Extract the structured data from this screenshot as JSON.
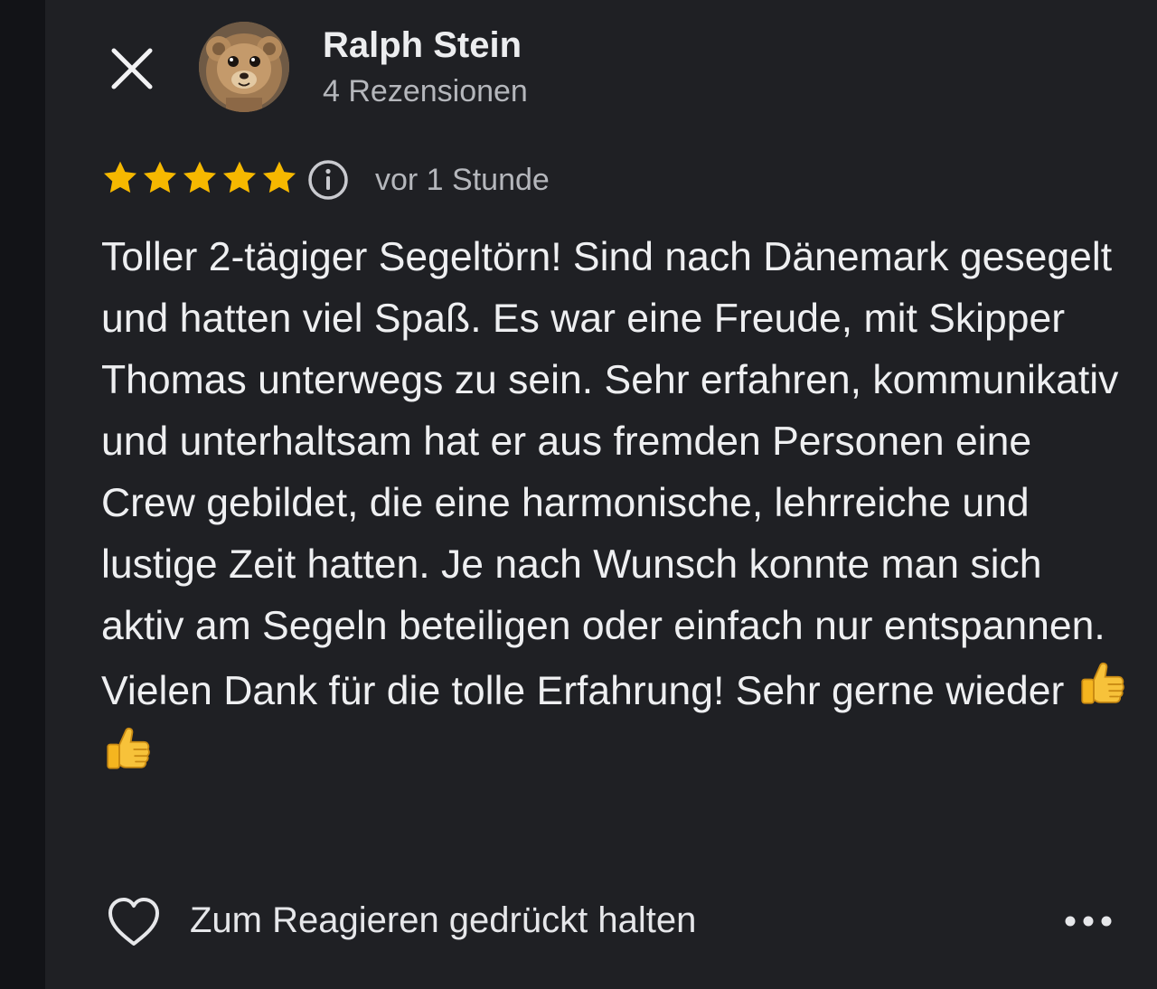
{
  "review": {
    "author": {
      "name": "Ralph Stein",
      "reviews_count": "4 Rezensionen",
      "avatar_icon": "teddy-bear-avatar"
    },
    "rating": 5,
    "rating_max": 5,
    "time": "vor 1 Stunde",
    "text": "Toller 2-tägiger Segeltörn! Sind nach Dänemark gesegelt und hatten viel Spaß. Es war eine Freude, mit Skipper Thomas unterwegs zu sein. Sehr erfahren, kommunikativ und unterhaltsam hat er aus fremden Personen eine Crew gebildet, die eine harmonische, lehrreiche und lustige Zeit hatten. Je nach Wunsch konnte man sich aktiv am Segeln beteiligen oder einfach nur entspannen. Vielen Dank für die tolle Erfahrung! Sehr gerne wieder",
    "trailing_emojis": [
      "thumbs-up",
      "thumbs-up"
    ]
  },
  "footer": {
    "react_label": "Zum Reagieren gedrückt halten"
  },
  "icons": {
    "close": "close-icon",
    "info": "info-icon",
    "heart": "heart-icon",
    "more": "more-icon",
    "star": "star-icon"
  },
  "colors": {
    "background": "#1f2024",
    "star": "#f6b800",
    "text": "#eeeff1",
    "secondary_text": "#b5b7bc"
  }
}
